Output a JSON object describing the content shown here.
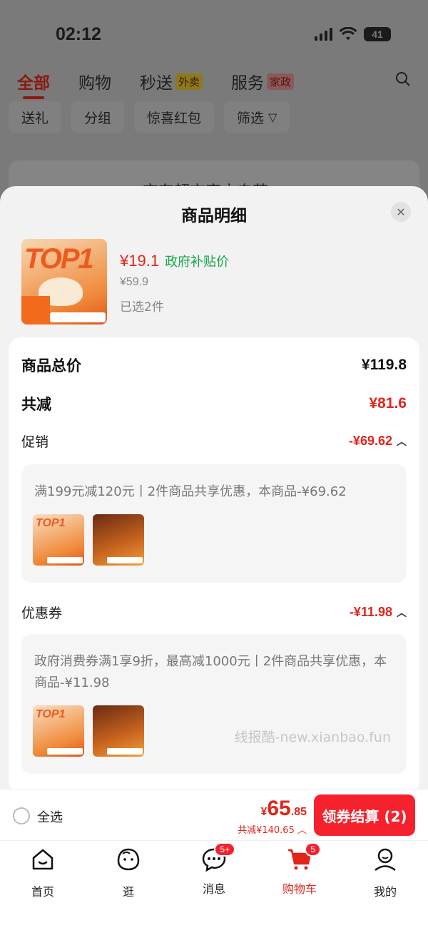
{
  "status_bar": {
    "time": "02:12",
    "battery": "41"
  },
  "top_tabs": [
    {
      "label": "全部",
      "badge": ""
    },
    {
      "label": "购物",
      "badge": ""
    },
    {
      "label": "秒送",
      "badge": "外卖"
    },
    {
      "label": "服务",
      "badge": "家政"
    }
  ],
  "filters": [
    "送礼",
    "分组",
    "惊喜红包",
    "筛选"
  ],
  "background_card_text": "京东超市官方自营",
  "sheet": {
    "title": "商品明细",
    "product": {
      "price": "¥19.1",
      "tag": "政府补贴价",
      "original_price": "¥59.9",
      "selected": "已选2件",
      "image_text": "TOP1"
    },
    "total_label": "商品总价",
    "total_value": "¥119.8",
    "reduce_label": "共减",
    "reduce_value": "¥81.6",
    "promo_label": "促销",
    "promo_value": "-¥69.62",
    "promo_desc": "满199元减120元丨2件商品共享优惠，本商品-¥69.62",
    "coupon_label": "优惠券",
    "coupon_value": "-¥11.98",
    "coupon_desc": "政府消费券满1享9折，最高减1000元丨2件商品共享优惠，本商品-¥11.98",
    "watermark": "线报酷-new.xianbao.fun"
  },
  "checkout": {
    "select_all": "全选",
    "currency": "¥",
    "total_int": "65",
    "total_dec": ".85",
    "discount": "共减¥140.65",
    "button": "领券结算 (2)"
  },
  "tabbar": [
    {
      "label": "首页",
      "icon": "home-icon",
      "badge": ""
    },
    {
      "label": "逛",
      "icon": "browse-icon",
      "badge": ""
    },
    {
      "label": "消息",
      "icon": "message-icon",
      "badge": "5+"
    },
    {
      "label": "购物车",
      "icon": "cart-icon",
      "badge": "5"
    },
    {
      "label": "我的",
      "icon": "profile-icon",
      "badge": ""
    }
  ],
  "colors": {
    "accent_red": "#e1251b",
    "button_red": "#f5222d",
    "gov_green": "#16a34a"
  }
}
